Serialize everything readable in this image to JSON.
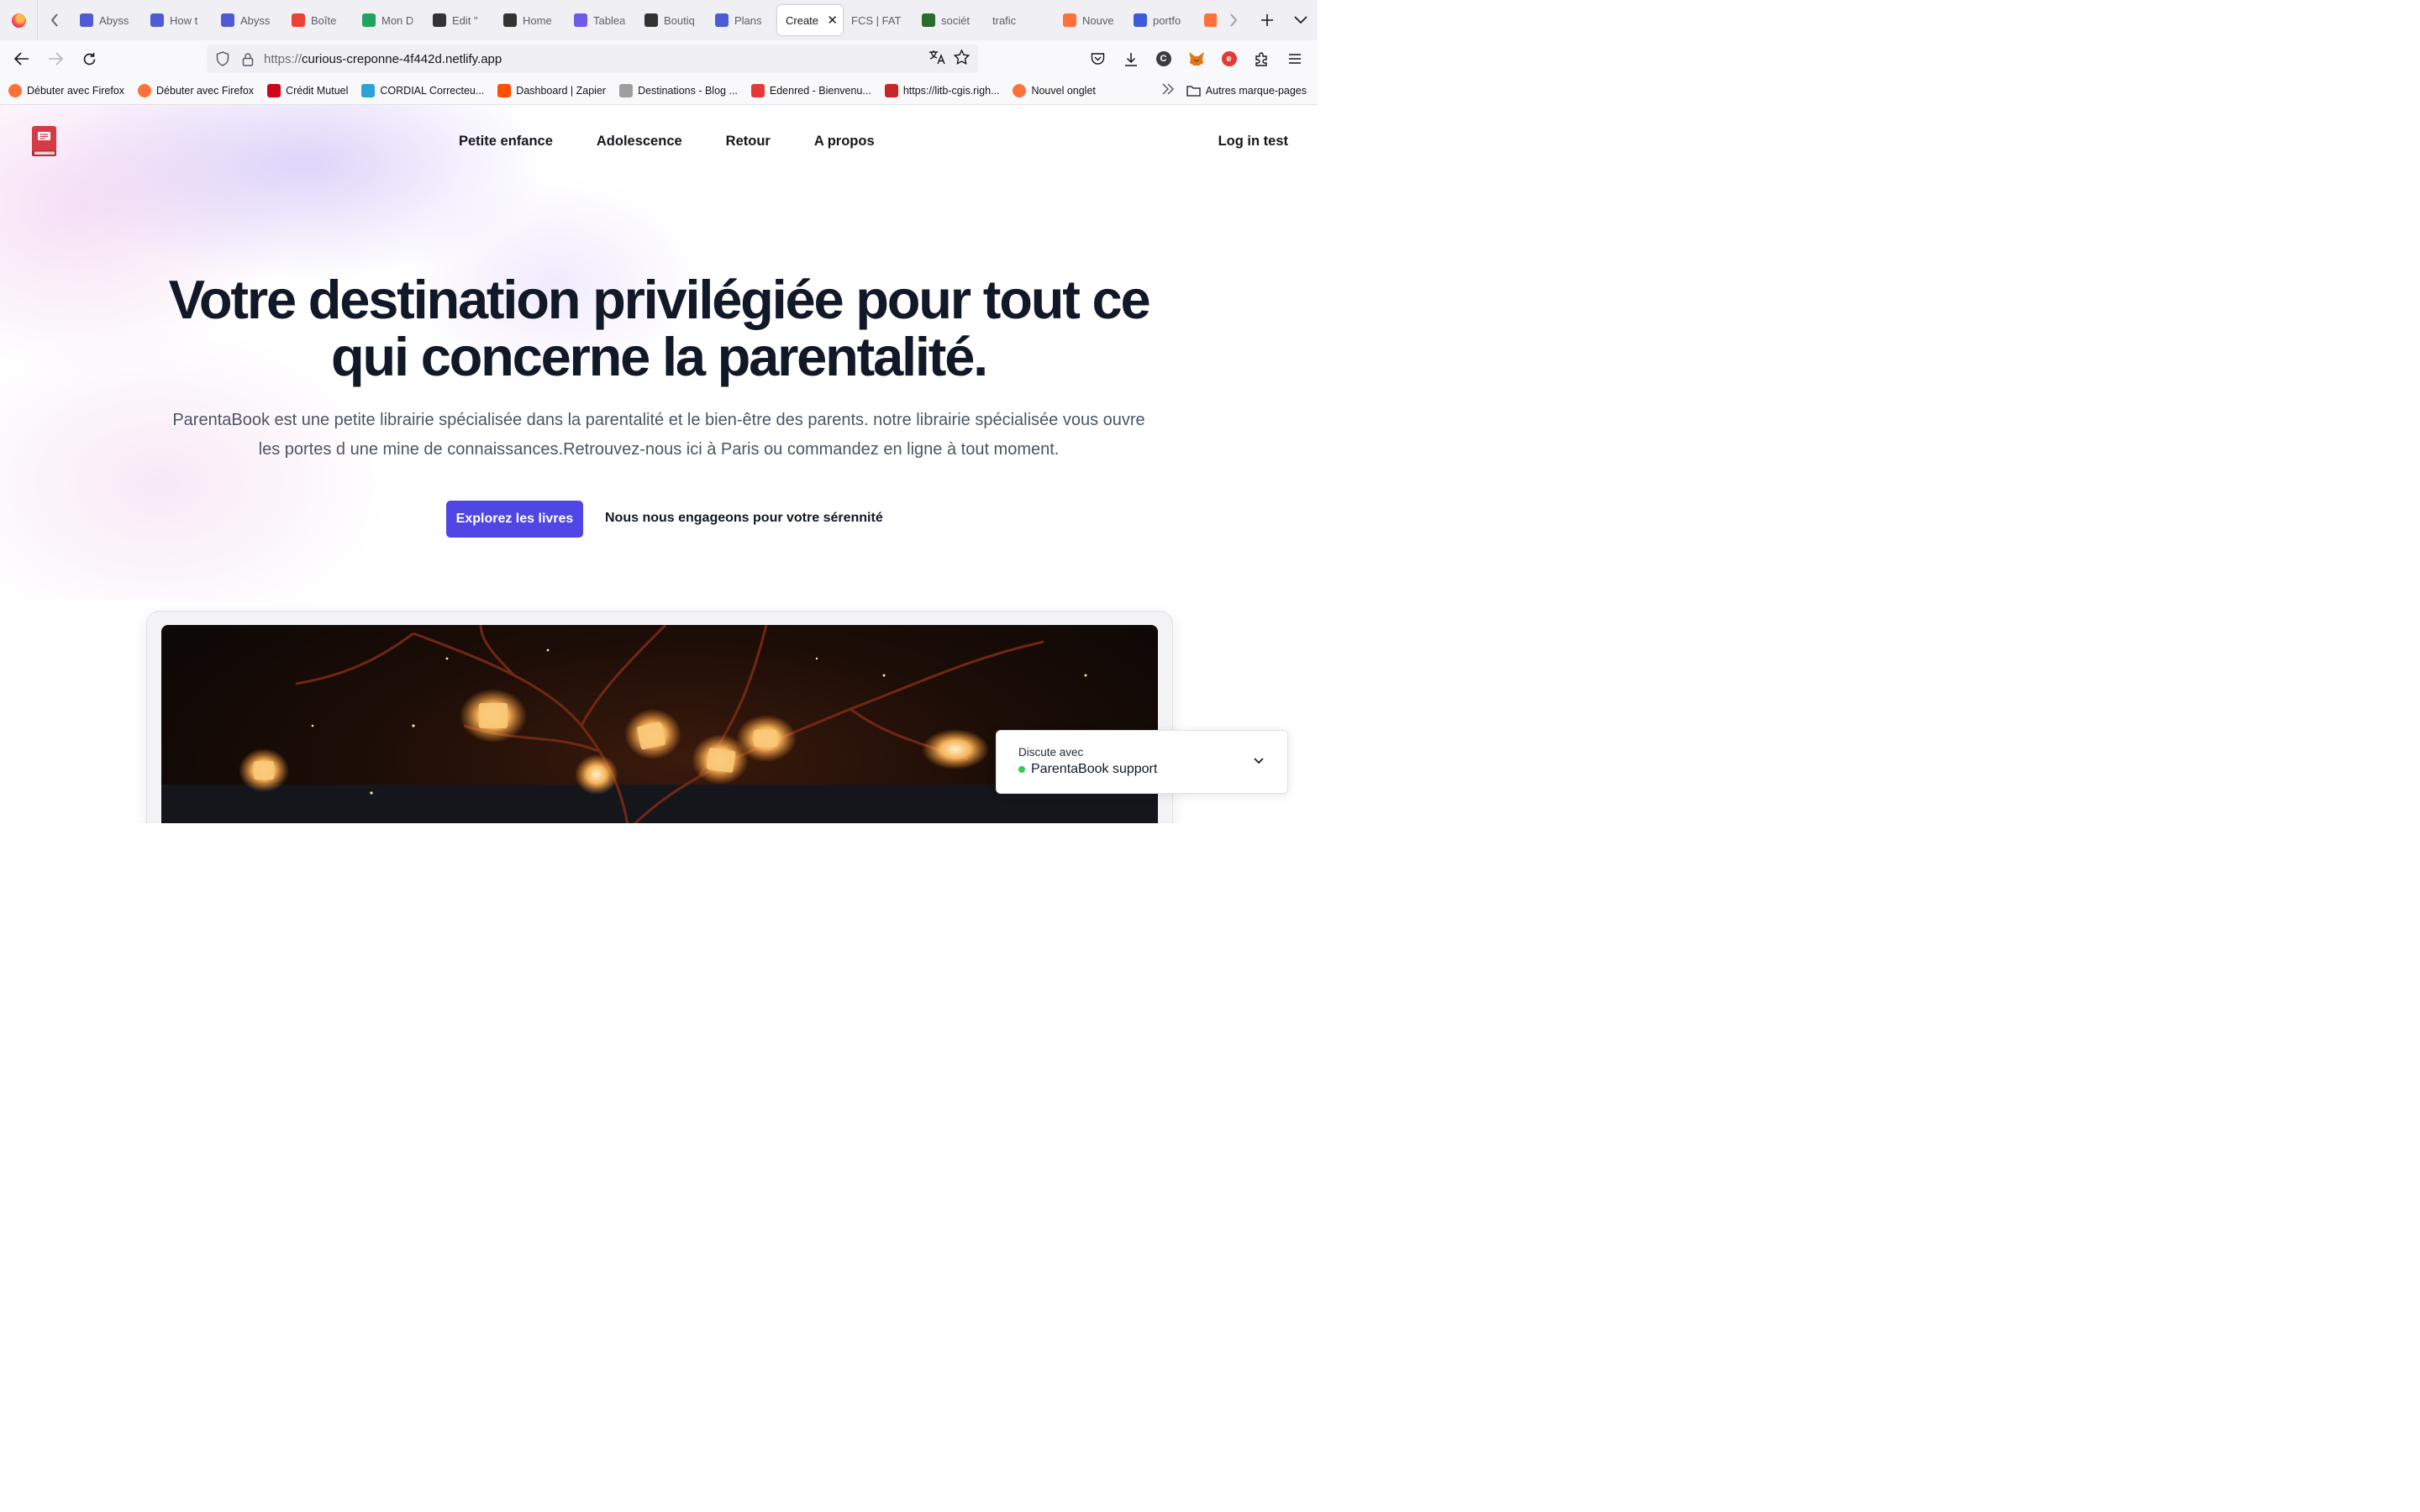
{
  "browser": {
    "tabs": [
      {
        "label": "Abyss",
        "favicon": "abyss-icon",
        "color": "#4f5bd5"
      },
      {
        "label": "How t",
        "favicon": "abyss-icon",
        "color": "#4f5bd5"
      },
      {
        "label": "Abyss",
        "favicon": "abyss-icon",
        "color": "#4f5bd5"
      },
      {
        "label": "Boîte",
        "favicon": "gmail-icon",
        "color": "#ea4335"
      },
      {
        "label": "Mon D",
        "favicon": "drive-icon",
        "color": "#1fa463"
      },
      {
        "label": "Edit \"",
        "favicon": "webflow-icon",
        "color": "#333333"
      },
      {
        "label": "Home",
        "favicon": "webflow-icon",
        "color": "#333333"
      },
      {
        "label": "Tablea",
        "favicon": "h-icon",
        "color": "#6c5ce7"
      },
      {
        "label": "Boutiq",
        "favicon": "webflow-icon",
        "color": "#333333"
      },
      {
        "label": "Plans",
        "favicon": "abyss-icon",
        "color": "#4f5bd5"
      },
      {
        "label": "Create",
        "favicon": "",
        "color": "#15141a",
        "active": true
      },
      {
        "label": "FCS | FAT",
        "favicon": "",
        "color": "#888888"
      },
      {
        "label": "sociét",
        "favicon": "ep-icon",
        "color": "#2d6a2d"
      },
      {
        "label": "trafic",
        "favicon": "",
        "color": "#888888"
      },
      {
        "label": "Nouve",
        "favicon": "firefox-icon",
        "color": "#ff7139"
      },
      {
        "label": "portfo",
        "favicon": "portfolio-icon",
        "color": "#3b5bdb"
      },
      {
        "label": "Nouve",
        "favicon": "firefox-icon",
        "color": "#ff7139"
      }
    ],
    "url_scheme": "https://",
    "url_host": "curious-creponne-4f442d.netlify.app",
    "bookmarks": [
      {
        "label": "Débuter avec Firefox",
        "icon": "firefox-icon",
        "color": "#ff7139"
      },
      {
        "label": "Débuter avec Firefox",
        "icon": "firefox-icon",
        "color": "#ff7139"
      },
      {
        "label": "Crédit Mutuel",
        "icon": "credit-mutuel-icon",
        "color": "#d0021b"
      },
      {
        "label": "CORDIAL Correcteu...",
        "icon": "cordial-icon",
        "color": "#2aa3d8"
      },
      {
        "label": "Dashboard | Zapier",
        "icon": "zapier-icon",
        "color": "#ff4f00"
      },
      {
        "label": "Destinations - Blog ...",
        "icon": "destinations-icon",
        "color": "#9e9e9e"
      },
      {
        "label": "Edenred - Bienvenu...",
        "icon": "edenred-icon",
        "color": "#e53935"
      },
      {
        "label": "https://litb-cgis.righ...",
        "icon": "in-icon",
        "color": "#c62828"
      },
      {
        "label": "Nouvel onglet",
        "icon": "firefox-icon",
        "color": "#ff7139"
      }
    ],
    "other_bookmarks": "Autres marque-pages"
  },
  "site": {
    "nav": [
      "Petite enfance",
      "Adolescence",
      "Retour",
      "A propos"
    ],
    "login": "Log in test",
    "hero_title": "Votre destination privilégiée pour tout ce qui concerne la parentalité.",
    "hero_text": "ParentaBook est une petite librairie spécialisée dans la parentalité et le bien-être des parents. notre librairie spécialisée vous ouvre les portes d une mine de connaissances.Retrouvez-nous ici à Paris ou commandez en ligne à tout moment.",
    "cta_primary": "Explorez les livres",
    "cta_secondary": "Nous nous engageons pour votre sérennité",
    "accent": "#4f46e5"
  },
  "chat": {
    "title": "Discute avec",
    "name": "ParentaBook support",
    "status_color": "#34c759"
  }
}
